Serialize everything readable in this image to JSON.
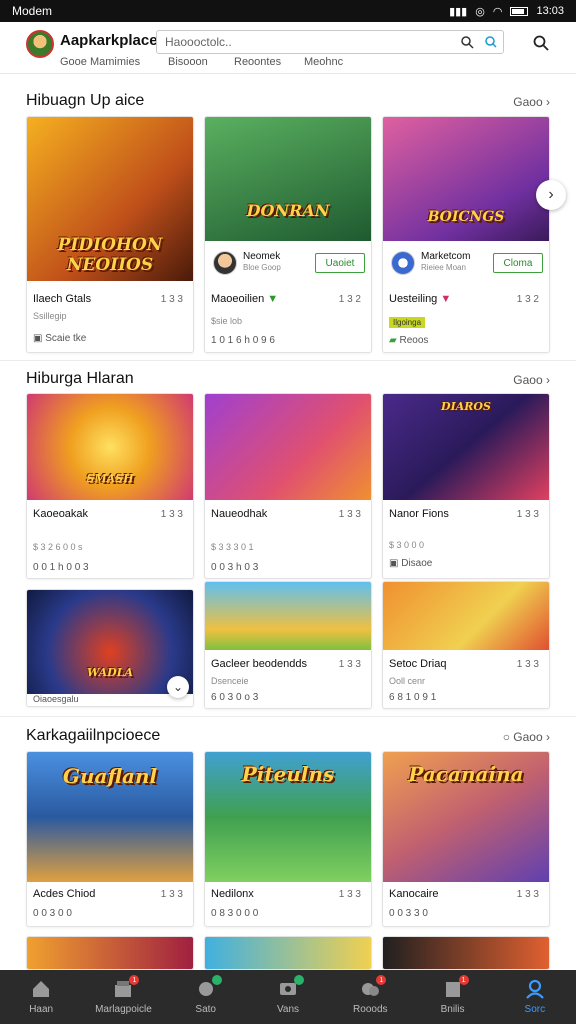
{
  "status_bar": {
    "left": "Modem",
    "time": "13:03"
  },
  "header": {
    "title": "Aapkarkplace",
    "search_value": "Haoooctolc..",
    "sub_tabs": [
      "Gooe Mamimies",
      "Bisooon",
      "Reoontes",
      "Meohnc"
    ]
  },
  "sections": [
    {
      "title": "Hibuagn Up aice",
      "see_all": "Gaoo",
      "cards": [
        {
          "name": "Ilaech Gtals",
          "ver": "1 3 3",
          "line2": "Ssillegip",
          "line3": "Scaie tke",
          "art_text": "PIDIOHON NEOIIOS",
          "colors": [
            "#f0a020",
            "#8a3a10"
          ]
        },
        {
          "name": "Maoeoilien",
          "ver": "1 3 2",
          "line2": "$sie lob",
          "line3": "1 0 1 6 h 0 9 6",
          "art_text": "DONRAN",
          "colors": [
            "#3a8a4a",
            "#1a4a2a"
          ],
          "dev": {
            "name": "Neomek",
            "sub": "Bloe Goop",
            "btn": "Uaoiet"
          }
        },
        {
          "name": "Uesteiling",
          "ver": "1 3 2",
          "line2": "Ilgoinga",
          "line3": "Reoos",
          "art_text": "BOICNGS",
          "colors": [
            "#d050a0",
            "#6a2a8a"
          ],
          "dev": {
            "name": "Marketcom",
            "sub": "Rieiee Moan",
            "btn": "Cloma"
          }
        }
      ]
    },
    {
      "title": "Hiburga Hlaran",
      "see_all": "Gaoo",
      "cards": [
        {
          "name": "Kaoeoakak",
          "ver": "1 3 3",
          "line2": "$ 3 2 6 0 0 s",
          "line3": "0 0 1 h 0 0 3",
          "art_text": "SMASH",
          "colors": [
            "#f0c030",
            "#d04070"
          ]
        },
        {
          "name": "Naueodhak",
          "ver": "1 3 3",
          "line2": "$ 3 3 3 0 1",
          "line3": "0 0 3 h 0 3",
          "art_text": "",
          "colors": [
            "#a040c0",
            "#f07040"
          ]
        },
        {
          "name": "Nanor Fions",
          "ver": "1 3 3",
          "line2": "$ 3 0 0 0",
          "line3": "Disaoe",
          "art_text": "DIAROS",
          "colors": [
            "#5a2a8a",
            "#e04060"
          ]
        },
        {
          "name": "Oiaoesgalu",
          "ver": "",
          "line2": "",
          "line3": "",
          "art_text": "WADLA",
          "colors": [
            "#2a3a8a",
            "#a03a20"
          ]
        },
        {
          "name": "Gacleer beodendds",
          "ver": "1 3 3",
          "line2": "Dsenceie",
          "line3": "6 0 3 0 o 3",
          "art_text": "",
          "colors": [
            "#4ab0e0",
            "#80c040"
          ]
        },
        {
          "name": "Setoc Driaq",
          "ver": "1 3 3",
          "line2": "Ooll cenr",
          "line3": "6 8 1 0 9 1",
          "art_text": "",
          "colors": [
            "#f08030",
            "#f0c040"
          ]
        }
      ]
    },
    {
      "title": "Karkagaiilnpcioece",
      "see_all": "Gaoo",
      "cards": [
        {
          "name": "Acdes Chiod",
          "ver": "1 3 3",
          "line2": "0 0 3 0 0",
          "line3": "",
          "art_text": "Guaflanl",
          "colors": [
            "#4a8ad0",
            "#e0a040"
          ]
        },
        {
          "name": "Nedilonx",
          "ver": "1 3 3",
          "line2": "0 8 3 0 0 0",
          "line3": "",
          "art_text": "Piteulns",
          "colors": [
            "#40a050",
            "#80d060"
          ]
        },
        {
          "name": "Kanocaire",
          "ver": "1 3 3",
          "line2": "0 0 3 3 0",
          "line3": "",
          "art_text": "Pacanaina",
          "colors": [
            "#e08040",
            "#8050c0"
          ]
        }
      ]
    }
  ],
  "bottom_nav": [
    {
      "label": "Haan",
      "icon": "home-icon",
      "badge": ""
    },
    {
      "label": "Marlagpoicle",
      "icon": "store-icon",
      "badge": "1"
    },
    {
      "label": "Sato",
      "icon": "gamepad-icon",
      "badge": ""
    },
    {
      "label": "Vans",
      "icon": "video-icon",
      "badge": ""
    },
    {
      "label": "Rooods",
      "icon": "rewards-icon",
      "badge": "1"
    },
    {
      "label": "Bnilis",
      "icon": "library-icon",
      "badge": "1"
    },
    {
      "label": "Sorc",
      "icon": "profile-icon",
      "badge": ""
    }
  ],
  "colors": {
    "accent": "#3b9cff",
    "nav_bg": "#2b2b2b",
    "install_green": "#3ca03c"
  }
}
